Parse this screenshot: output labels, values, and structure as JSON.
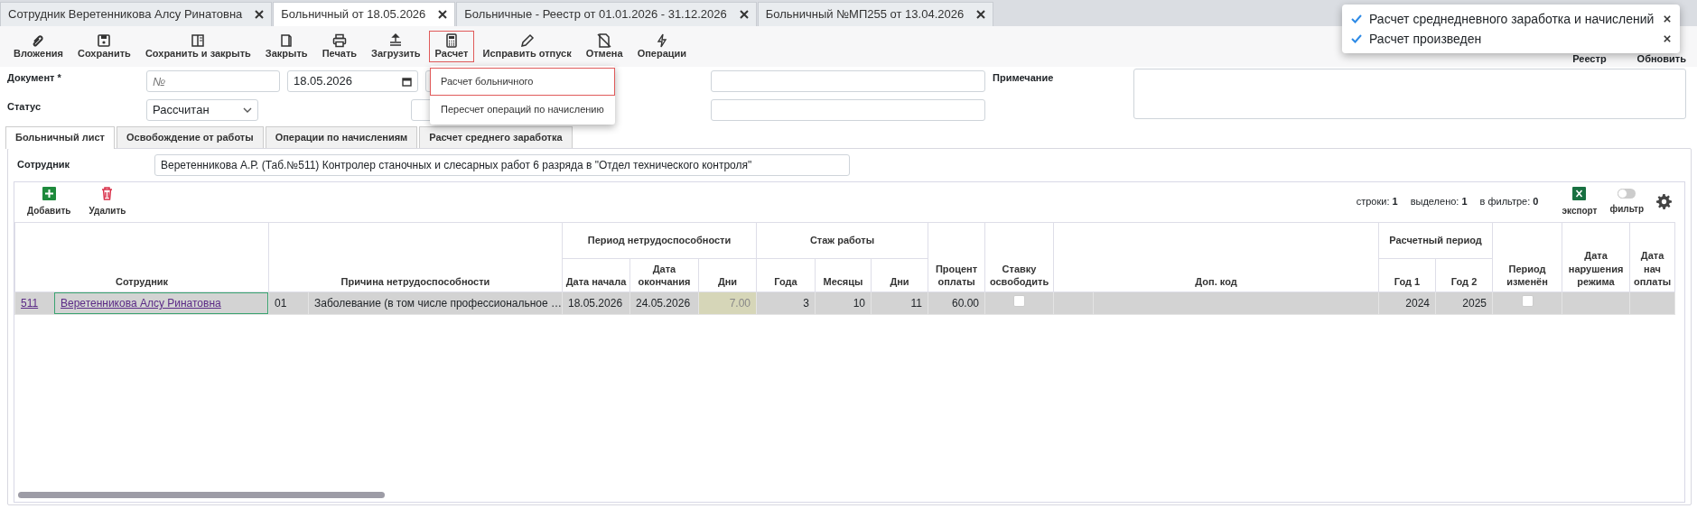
{
  "tabs": [
    {
      "label": "Сотрудник Веретенникова Алсу Ринатовна",
      "selected": false
    },
    {
      "label": "Больничный от 18.05.2026",
      "selected": true
    },
    {
      "label": "Больничные - Реестр от 01.01.2026 - 31.12.2026",
      "selected": false
    },
    {
      "label": "Больничный №МП255 от 13.04.2026",
      "selected": false
    }
  ],
  "toolbar": {
    "buttons": [
      {
        "label": "Вложения",
        "active": false
      },
      {
        "label": "Сохранить",
        "active": false
      },
      {
        "label": "Сохранить и закрыть",
        "active": false
      },
      {
        "label": "Закрыть",
        "active": false
      },
      {
        "label": "Печать",
        "active": false
      },
      {
        "label": "Загрузить",
        "active": false
      },
      {
        "label": "Расчет",
        "active": true
      },
      {
        "label": "Исправить отпуск",
        "active": false
      },
      {
        "label": "Отмена",
        "active": false
      },
      {
        "label": "Операции",
        "active": false
      }
    ],
    "right": [
      "Реестр",
      "Обновить"
    ]
  },
  "dropdown": {
    "items": [
      {
        "label": "Расчет больничного",
        "selected": true
      },
      {
        "label": "Пересчет операций по начислению",
        "selected": false
      }
    ]
  },
  "notifications": [
    {
      "text": "Расчет среднедневного заработка и начислений"
    },
    {
      "text": "Расчет произведен"
    }
  ],
  "form": {
    "document_label": "Документ *",
    "number_placeholder": "№",
    "date": "18.05.2026",
    "status_label": "Статус",
    "status": "Рассчитан",
    "note_label": "Примечание"
  },
  "section_tabs": [
    {
      "label": "Больничный лист",
      "selected": true
    },
    {
      "label": "Освобождение от работы",
      "selected": false
    },
    {
      "label": "Операции по начислениям",
      "selected": false
    },
    {
      "label": "Расчет среднего заработка",
      "selected": false
    }
  ],
  "employee": {
    "label": "Сотрудник",
    "value": "Веретенникова А.Р. (Таб.№511) Контролер станочных и слесарных работ 6 разряда в \"Отдел технического контроля\""
  },
  "grid": {
    "buttons": [
      {
        "label": "Добавить",
        "kind": "add"
      },
      {
        "label": "Удалить",
        "kind": "delete"
      }
    ],
    "stats": [
      "строки: **1**",
      "выделено: **1**",
      "в фильтре: **0**"
    ],
    "export_label": "экспорт",
    "filter": {
      "label": "фильтр",
      "on": false
    },
    "header": [
      {
        "title": "Сотрудник"
      },
      {
        "title": "Причина нетрудоспособности"
      },
      {
        "title": "Период нетрудоспособности",
        "subcolumns": [
          {
            "title": "Дата начала"
          },
          {
            "title": "Дата окончания"
          },
          {
            "title": "Дни"
          }
        ]
      },
      {
        "title": "Стаж работы",
        "subcolumns": [
          {
            "title": "Года"
          },
          {
            "title": "Месяцы"
          },
          {
            "title": "Дни"
          }
        ]
      },
      {
        "title": "Процент оплаты"
      },
      {
        "title": "Ставку освободить"
      },
      {
        "title": "Доп. код"
      },
      {
        "title": "Расчетный период",
        "subcolumns": [
          {
            "title": "Год 1"
          },
          {
            "title": "Год 2"
          }
        ]
      },
      {
        "title": "Период изменён"
      },
      {
        "title": "Дата нарушения режима"
      },
      {
        "title": "Дата нач оплаты"
      }
    ],
    "rows": [
      {
        "selected": true,
        "cells": [
          {
            "kind": "links",
            "parts": [
              {
                "text": "511"
              },
              {
                "text": "Веретенникова Алсу Ринатовна",
                "focused": true
              }
            ]
          },
          {
            "kind": "texts",
            "parts": [
              {
                "text": "01"
              },
              {
                "text": "Заболевание (в том числе профессиональное …"
              }
            ]
          },
          {
            "kind": "text",
            "text": "18.05.2026"
          },
          {
            "kind": "text",
            "text": "24.05.2026"
          },
          {
            "kind": "num",
            "text": "7.00",
            "highlight": true
          },
          {
            "kind": "num",
            "text": "3"
          },
          {
            "kind": "num",
            "text": "10"
          },
          {
            "kind": "num",
            "text": "11"
          },
          {
            "kind": "num",
            "text": "60.00"
          },
          {
            "kind": "check",
            "checked": false
          },
          {
            "kind": "split"
          },
          {
            "kind": "num",
            "text": "2024"
          },
          {
            "kind": "num",
            "text": "2025"
          },
          {
            "kind": "check",
            "checked": false
          },
          {
            "kind": "empty"
          },
          {
            "kind": "empty"
          }
        ]
      }
    ]
  }
}
